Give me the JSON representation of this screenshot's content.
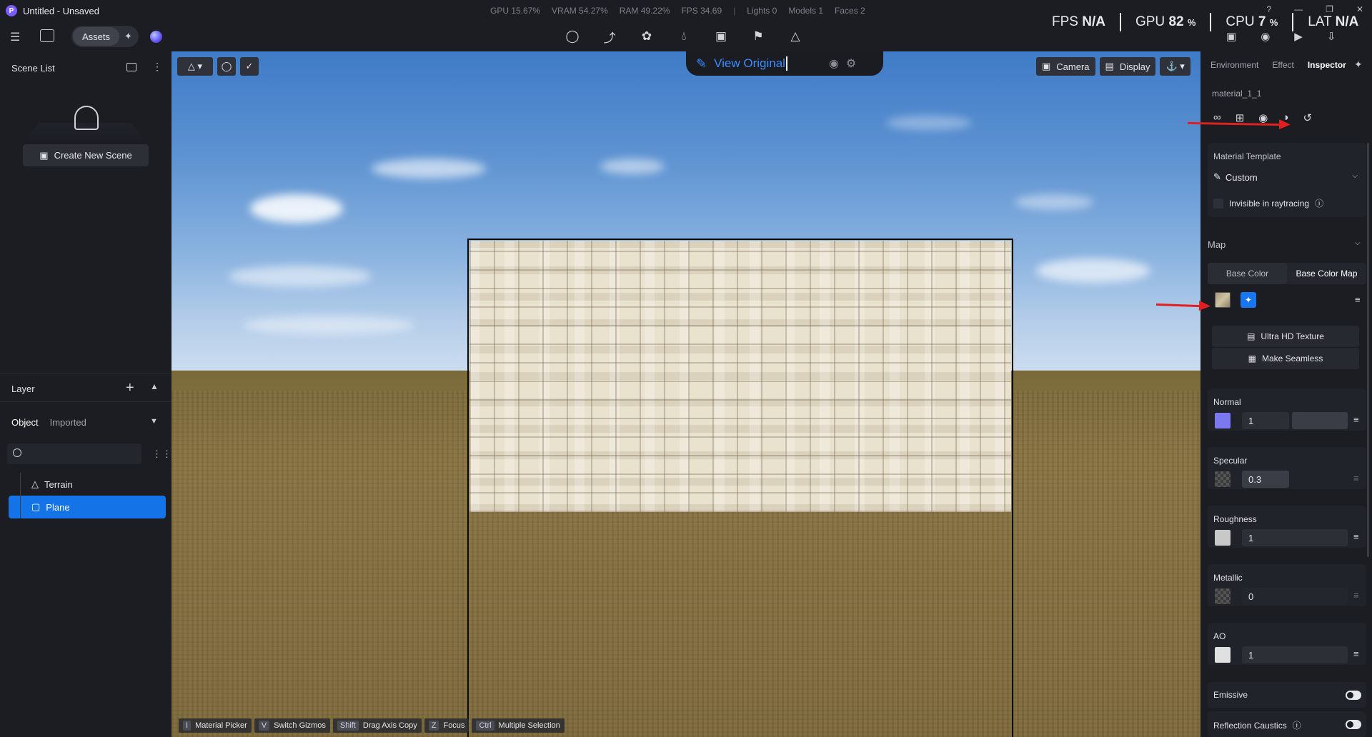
{
  "app": {
    "logo_letter": "P",
    "title": "Untitled - Unsaved"
  },
  "stats": {
    "gpu": "GPU 15.67%",
    "vram": "VRAM 54.27%",
    "ram": "RAM 49.22%",
    "fps": "FPS 34.69",
    "separator": "|",
    "lights": "Lights 0",
    "models": "Models 1",
    "faces": "Faces 2"
  },
  "perf": {
    "fps_label": "FPS",
    "fps_value": "N/A",
    "gpu_label": "GPU",
    "gpu_value": "82",
    "gpu_unit": "%",
    "cpu_label": "CPU",
    "cpu_value": "7",
    "cpu_unit": "%",
    "lat_label": "LAT",
    "lat_value": "N/A"
  },
  "toolbar": {
    "assets_label": "Assets"
  },
  "scene_list": {
    "header": "Scene List",
    "create_button": "Create New Scene"
  },
  "layer": {
    "label": "Layer",
    "add": "+"
  },
  "objects": {
    "tab_object": "Object",
    "tab_imported": "Imported",
    "items": [
      {
        "label": "Terrain",
        "icon": "terrain-icon"
      },
      {
        "label": "Plane",
        "icon": "cube-icon",
        "selected": true
      }
    ]
  },
  "viewport": {
    "view_original": "View Original",
    "camera": "Camera",
    "display": "Display",
    "shortcuts": [
      {
        "key": "I",
        "label": "Material Picker"
      },
      {
        "key": "V",
        "label": "Switch Gizmos"
      },
      {
        "key": "Shift",
        "label": "Drag Axis Copy"
      },
      {
        "key": "Z",
        "label": "Focus"
      },
      {
        "key": "Ctrl",
        "label": "Multiple Selection"
      }
    ]
  },
  "inspector": {
    "tabs": [
      "Environment",
      "Effect",
      "Inspector"
    ],
    "material_name": "material_1_1",
    "template_label": "Material Template",
    "template_value": "Custom",
    "invisible_label": "Invisible in raytracing",
    "map_header": "Map",
    "map_tab_color": "Base Color",
    "map_tab_map": "Base Color Map",
    "uhd_button": "Ultra HD Texture",
    "seamless_button": "Make Seamless",
    "props": [
      {
        "title": "Normal",
        "value": "1"
      },
      {
        "title": "Specular",
        "value": "0.3"
      },
      {
        "title": "Roughness",
        "value": "1"
      },
      {
        "title": "Metallic",
        "value": "0"
      },
      {
        "title": "AO",
        "value": "1"
      }
    ],
    "emissive_label": "Emissive",
    "caustics_label": "Reflection Caustics"
  },
  "colors": {
    "accent": "#1473e6",
    "view_original": "#3b8cff",
    "annotation_arrow": "#e02020",
    "normal_swatch": "#7b78f0"
  }
}
